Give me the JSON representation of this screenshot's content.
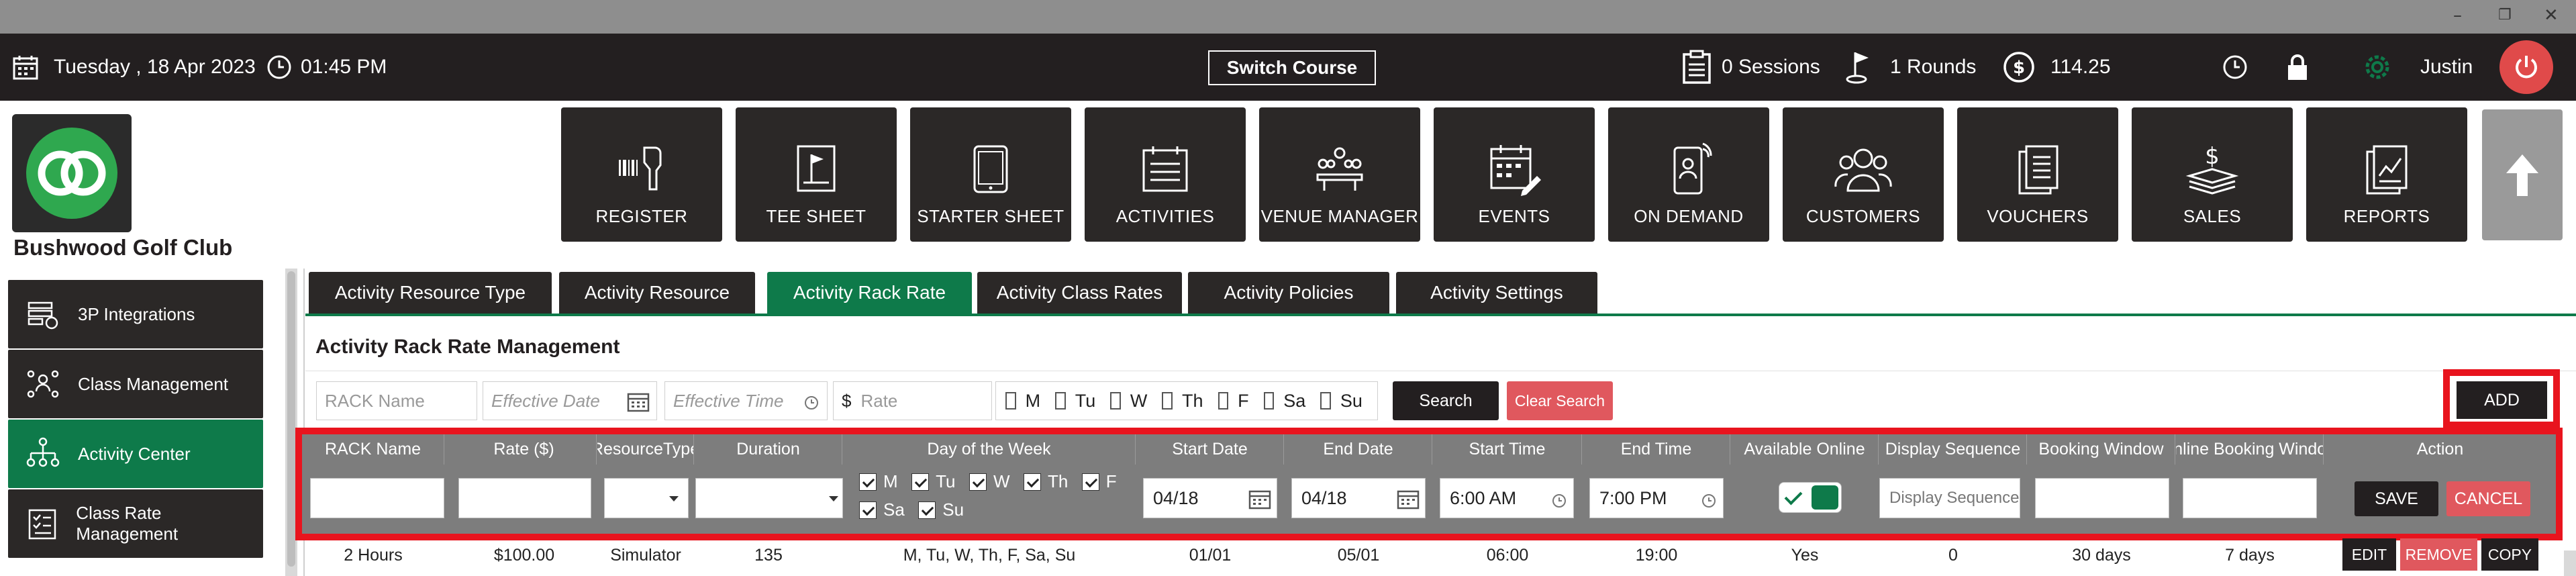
{
  "header": {
    "date": "Tuesday ,  18 Apr 2023",
    "time": "01:45 PM",
    "switch_course": "Switch Course",
    "sessions": "0 Sessions",
    "rounds": "1 Rounds",
    "balance": "114.25",
    "user": "Justin"
  },
  "club": {
    "name": "Bushwood Golf Club"
  },
  "nav": [
    {
      "label": "REGISTER",
      "icon": "barcode-scanner-icon"
    },
    {
      "label": "TEE SHEET",
      "icon": "flag-sheet-icon"
    },
    {
      "label": "STARTER SHEET",
      "icon": "tablet-icon"
    },
    {
      "label": "ACTIVITIES",
      "icon": "calendar-list-icon"
    },
    {
      "label": "VENUE MANAGER",
      "icon": "meeting-icon"
    },
    {
      "label": "EVENTS",
      "icon": "calendar-edit-icon"
    },
    {
      "label": "ON DEMAND",
      "icon": "phone-icon"
    },
    {
      "label": "CUSTOMERS",
      "icon": "users-icon"
    },
    {
      "label": "VOUCHERS",
      "icon": "documents-icon"
    },
    {
      "label": "SALES",
      "icon": "cash-icon"
    },
    {
      "label": "REPORTS",
      "icon": "report-chart-icon"
    }
  ],
  "sidebar": [
    {
      "label": "3P Integrations"
    },
    {
      "label": "Class Management"
    },
    {
      "label": "Activity  Center"
    },
    {
      "label": "Class Rate Management"
    }
  ],
  "tabs": [
    {
      "label": "Activity Resource Type"
    },
    {
      "label": "Activity Resource"
    },
    {
      "label": "Activity Rack Rate"
    },
    {
      "label": "Activity Class Rates"
    },
    {
      "label": "Activity Policies"
    },
    {
      "label": "Activity Settings"
    }
  ],
  "page": {
    "title": "Activity Rack Rate Management"
  },
  "filters": {
    "rack_name_ph": "RACK Name",
    "effective_date_ph": "Effective Date",
    "effective_time_ph": "Effective Time",
    "currency": "$",
    "rate_ph": "Rate",
    "days": [
      "M",
      "Tu",
      "W",
      "Th",
      "F",
      "Sa",
      "Su"
    ],
    "search": "Search",
    "clear": "Clear Search",
    "add": "ADD"
  },
  "grid": {
    "columns": [
      "RACK Name",
      "Rate ($)",
      "ResourceType",
      "Duration",
      "Day of the Week",
      "Start Date",
      "End Date",
      "Start Time",
      "End Time",
      "Available Online",
      "Display Sequence",
      "Booking Window",
      "Online Booking Window",
      "Action"
    ],
    "edit": {
      "days_row1": [
        "M",
        "Tu",
        "W",
        "Th",
        "F"
      ],
      "days_row2": [
        "Sa",
        "Su"
      ],
      "start_date": "04/18",
      "end_date": "04/18",
      "start_time": "6:00 AM",
      "end_time": "7:00 PM",
      "display_seq_ph": "Display Sequence",
      "save": "SAVE",
      "cancel": "CANCEL"
    },
    "rows": [
      {
        "rack_name": "2 Hours",
        "rate": "$100.00",
        "resource_type": "Simulator",
        "duration": "135",
        "days": "M, Tu, W, Th, F, Sa, Su",
        "start_date": "01/01",
        "end_date": "05/01",
        "start_time": "06:00",
        "end_time": "19:00",
        "online": "Yes",
        "display_seq": "0",
        "booking_window": "30 days",
        "online_booking_window": "7 days"
      }
    ],
    "row_actions": {
      "edit": "EDIT",
      "remove": "REMOVE",
      "copy": "COPY"
    }
  },
  "colors": {
    "brand_green": "#0e7a4a",
    "dark": "#231f20",
    "danger": "#e0585e",
    "highlight": "#e8141e"
  }
}
